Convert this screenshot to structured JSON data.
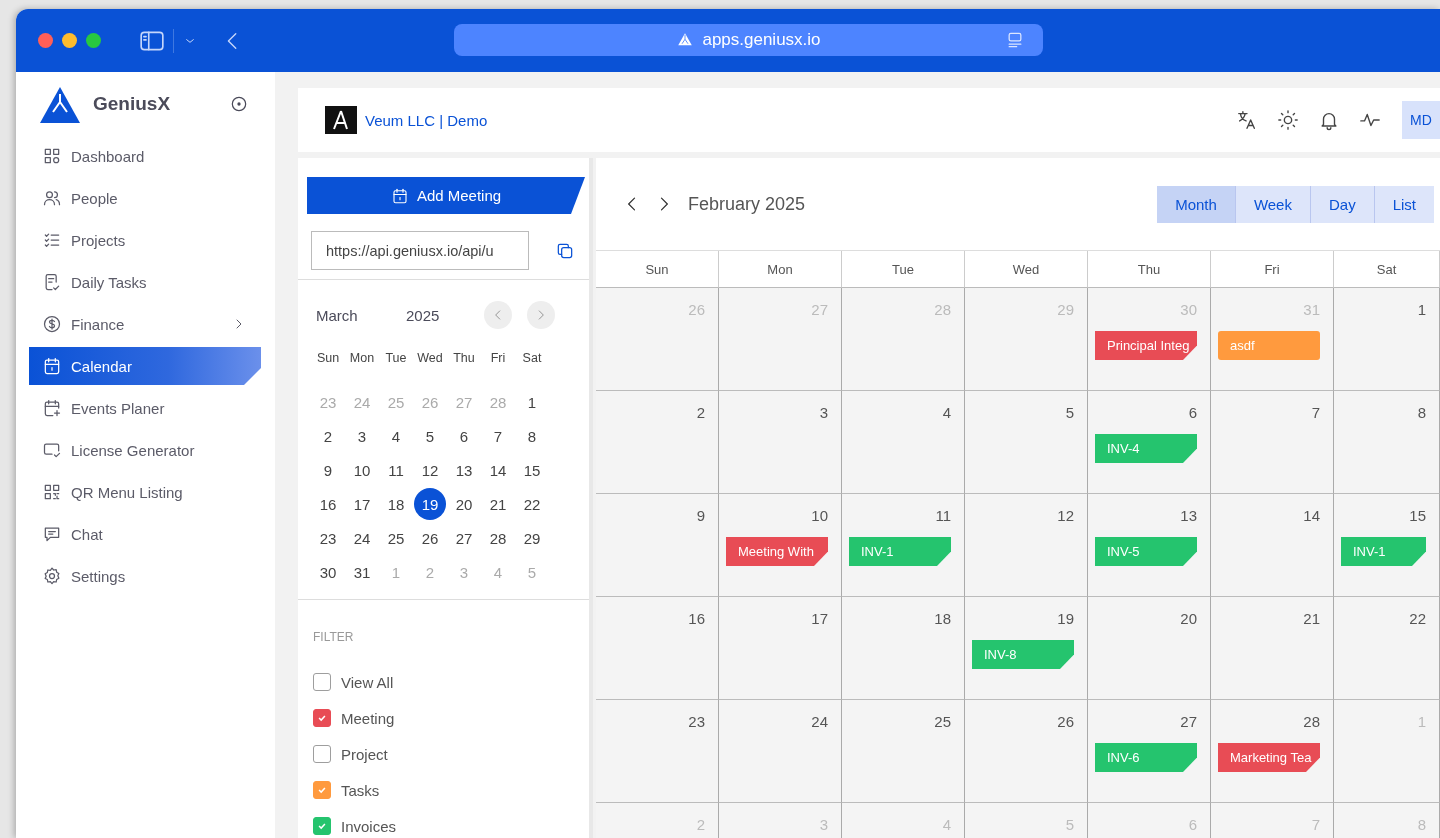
{
  "browser": {
    "url": "apps.geniusx.io"
  },
  "sidebar": {
    "brand": "GeniusX",
    "items": [
      {
        "label": "Dashboard",
        "selected": false,
        "has_submenu": false
      },
      {
        "label": "People",
        "selected": false,
        "has_submenu": false
      },
      {
        "label": "Projects",
        "selected": false,
        "has_submenu": false
      },
      {
        "label": "Daily Tasks",
        "selected": false,
        "has_submenu": false
      },
      {
        "label": "Finance",
        "selected": false,
        "has_submenu": true
      },
      {
        "label": "Calendar",
        "selected": true,
        "has_submenu": false
      },
      {
        "label": "Events Planer",
        "selected": false,
        "has_submenu": false
      },
      {
        "label": "License Generator",
        "selected": false,
        "has_submenu": false
      },
      {
        "label": "QR Menu Listing",
        "selected": false,
        "has_submenu": false
      },
      {
        "label": "Chat",
        "selected": false,
        "has_submenu": false
      },
      {
        "label": "Settings",
        "selected": false,
        "has_submenu": false
      }
    ]
  },
  "header": {
    "company": "Veum LLC | Demo",
    "avatar": "MD"
  },
  "left_panel": {
    "add_button": "Add Meeting",
    "feed_url": "https://api.geniusx.io/api/u",
    "mini_calendar": {
      "month": "March",
      "year": "2025",
      "weekdays": [
        "Sun",
        "Mon",
        "Tue",
        "Wed",
        "Thu",
        "Fri",
        "Sat"
      ],
      "weeks": [
        [
          {
            "day": "23",
            "muted": true,
            "selected": false
          },
          {
            "day": "24",
            "muted": true,
            "selected": false
          },
          {
            "day": "25",
            "muted": true,
            "selected": false
          },
          {
            "day": "26",
            "muted": true,
            "selected": false
          },
          {
            "day": "27",
            "muted": true,
            "selected": false
          },
          {
            "day": "28",
            "muted": true,
            "selected": false
          },
          {
            "day": "1",
            "muted": false,
            "selected": false
          }
        ],
        [
          {
            "day": "2",
            "muted": false,
            "selected": false
          },
          {
            "day": "3",
            "muted": false,
            "selected": false
          },
          {
            "day": "4",
            "muted": false,
            "selected": false
          },
          {
            "day": "5",
            "muted": false,
            "selected": false
          },
          {
            "day": "6",
            "muted": false,
            "selected": false
          },
          {
            "day": "7",
            "muted": false,
            "selected": false
          },
          {
            "day": "8",
            "muted": false,
            "selected": false
          }
        ],
        [
          {
            "day": "9",
            "muted": false,
            "selected": false
          },
          {
            "day": "10",
            "muted": false,
            "selected": false
          },
          {
            "day": "11",
            "muted": false,
            "selected": false
          },
          {
            "day": "12",
            "muted": false,
            "selected": false
          },
          {
            "day": "13",
            "muted": false,
            "selected": false
          },
          {
            "day": "14",
            "muted": false,
            "selected": false
          },
          {
            "day": "15",
            "muted": false,
            "selected": false
          }
        ],
        [
          {
            "day": "16",
            "muted": false,
            "selected": false
          },
          {
            "day": "17",
            "muted": false,
            "selected": false
          },
          {
            "day": "18",
            "muted": false,
            "selected": false
          },
          {
            "day": "19",
            "muted": false,
            "selected": true
          },
          {
            "day": "20",
            "muted": false,
            "selected": false
          },
          {
            "day": "21",
            "muted": false,
            "selected": false
          },
          {
            "day": "22",
            "muted": false,
            "selected": false
          }
        ],
        [
          {
            "day": "23",
            "muted": false,
            "selected": false
          },
          {
            "day": "24",
            "muted": false,
            "selected": false
          },
          {
            "day": "25",
            "muted": false,
            "selected": false
          },
          {
            "day": "26",
            "muted": false,
            "selected": false
          },
          {
            "day": "27",
            "muted": false,
            "selected": false
          },
          {
            "day": "28",
            "muted": false,
            "selected": false
          },
          {
            "day": "29",
            "muted": false,
            "selected": false
          }
        ],
        [
          {
            "day": "30",
            "muted": false,
            "selected": false
          },
          {
            "day": "31",
            "muted": false,
            "selected": false
          },
          {
            "day": "1",
            "muted": true,
            "selected": false
          },
          {
            "day": "2",
            "muted": true,
            "selected": false
          },
          {
            "day": "3",
            "muted": true,
            "selected": false
          },
          {
            "day": "4",
            "muted": true,
            "selected": false
          },
          {
            "day": "5",
            "muted": true,
            "selected": false
          }
        ]
      ]
    },
    "filter": {
      "title": "FILTER",
      "items": [
        {
          "label": "View All",
          "checked": false,
          "color": "#9e9e9e"
        },
        {
          "label": "Meeting",
          "checked": true,
          "color": "#e84c55"
        },
        {
          "label": "Project",
          "checked": false,
          "color": "#9e9e9e"
        },
        {
          "label": "Tasks",
          "checked": true,
          "color": "#ff9a3e"
        },
        {
          "label": "Invoices",
          "checked": true,
          "color": "#25c46e"
        }
      ]
    }
  },
  "calendar": {
    "title": "February 2025",
    "views": [
      {
        "label": "Month",
        "selected": true
      },
      {
        "label": "Week",
        "selected": false
      },
      {
        "label": "Day",
        "selected": false
      },
      {
        "label": "List",
        "selected": false
      }
    ],
    "weekdays": [
      "Sun",
      "Mon",
      "Tue",
      "Wed",
      "Thu",
      "Fri",
      "Sat"
    ],
    "weeks": [
      [
        {
          "day": "26",
          "muted": true
        },
        {
          "day": "27",
          "muted": true
        },
        {
          "day": "28",
          "muted": true
        },
        {
          "day": "29",
          "muted": true
        },
        {
          "day": "30",
          "muted": true,
          "events": [
            {
              "label": "Principal Integ",
              "kind": "meeting",
              "color": "#e84c55"
            }
          ]
        },
        {
          "day": "31",
          "muted": true,
          "events": [
            {
              "label": "asdf",
              "kind": "task",
              "color": "#ff9a3e"
            }
          ]
        },
        {
          "day": "1",
          "muted": false
        }
      ],
      [
        {
          "day": "2",
          "muted": false
        },
        {
          "day": "3",
          "muted": false
        },
        {
          "day": "4",
          "muted": false
        },
        {
          "day": "5",
          "muted": false
        },
        {
          "day": "6",
          "muted": false,
          "events": [
            {
              "label": "INV-4",
              "kind": "invoice",
              "color": "#25c46e"
            }
          ]
        },
        {
          "day": "7",
          "muted": false
        },
        {
          "day": "8",
          "muted": false
        }
      ],
      [
        {
          "day": "9",
          "muted": false
        },
        {
          "day": "10",
          "muted": false,
          "events": [
            {
              "label": "Meeting With",
              "kind": "meeting",
              "color": "#e84c55"
            }
          ]
        },
        {
          "day": "11",
          "muted": false,
          "events": [
            {
              "label": "INV-1",
              "kind": "invoice",
              "color": "#25c46e"
            }
          ]
        },
        {
          "day": "12",
          "muted": false
        },
        {
          "day": "13",
          "muted": false,
          "events": [
            {
              "label": "INV-5",
              "kind": "invoice",
              "color": "#25c46e"
            }
          ]
        },
        {
          "day": "14",
          "muted": false
        },
        {
          "day": "15",
          "muted": false,
          "events": [
            {
              "label": "INV-1",
              "kind": "invoice",
              "color": "#25c46e"
            }
          ]
        }
      ],
      [
        {
          "day": "16",
          "muted": false
        },
        {
          "day": "17",
          "muted": false
        },
        {
          "day": "18",
          "muted": false
        },
        {
          "day": "19",
          "muted": false,
          "events": [
            {
              "label": "INV-8",
              "kind": "invoice",
              "color": "#25c46e"
            }
          ]
        },
        {
          "day": "20",
          "muted": false
        },
        {
          "day": "21",
          "muted": false
        },
        {
          "day": "22",
          "muted": false
        }
      ],
      [
        {
          "day": "23",
          "muted": false
        },
        {
          "day": "24",
          "muted": false
        },
        {
          "day": "25",
          "muted": false
        },
        {
          "day": "26",
          "muted": false
        },
        {
          "day": "27",
          "muted": false,
          "events": [
            {
              "label": "INV-6",
              "kind": "invoice",
              "color": "#25c46e"
            }
          ]
        },
        {
          "day": "28",
          "muted": false,
          "events": [
            {
              "label": "Marketing Tea",
              "kind": "meeting",
              "color": "#e84c55"
            }
          ]
        },
        {
          "day": "1",
          "muted": true
        }
      ],
      [
        {
          "day": "2",
          "muted": true
        },
        {
          "day": "3",
          "muted": true
        },
        {
          "day": "4",
          "muted": true
        },
        {
          "day": "5",
          "muted": true
        },
        {
          "day": "6",
          "muted": true
        },
        {
          "day": "7",
          "muted": true
        },
        {
          "day": "8",
          "muted": true
        }
      ]
    ]
  }
}
